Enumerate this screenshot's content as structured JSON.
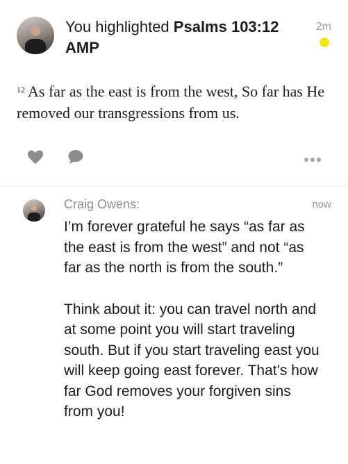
{
  "highlight": {
    "prefix": "You highlighted",
    "reference": "Psalms 103:12",
    "version": "AMP",
    "time": "2m",
    "dot_color": "#F2E51A",
    "verse_number": "12",
    "verse_text": "As far as the east is from the west, So far has He removed our transgressions from us."
  },
  "actions": {
    "like_icon": "heart-icon",
    "comment_icon": "speech-bubble-icon",
    "more_icon": "ellipsis-icon"
  },
  "comment": {
    "author": "Craig Owens:",
    "time": "now",
    "paragraphs": [
      "I’m forever grateful he says “as far as the east is from the west” and not “as far as the north is from the south.”",
      "Think about it: you can travel north and at some point you will start traveling south. But if you start traveling east you will keep going east forever. That’s how far God removes your forgiven sins from you!"
    ]
  }
}
